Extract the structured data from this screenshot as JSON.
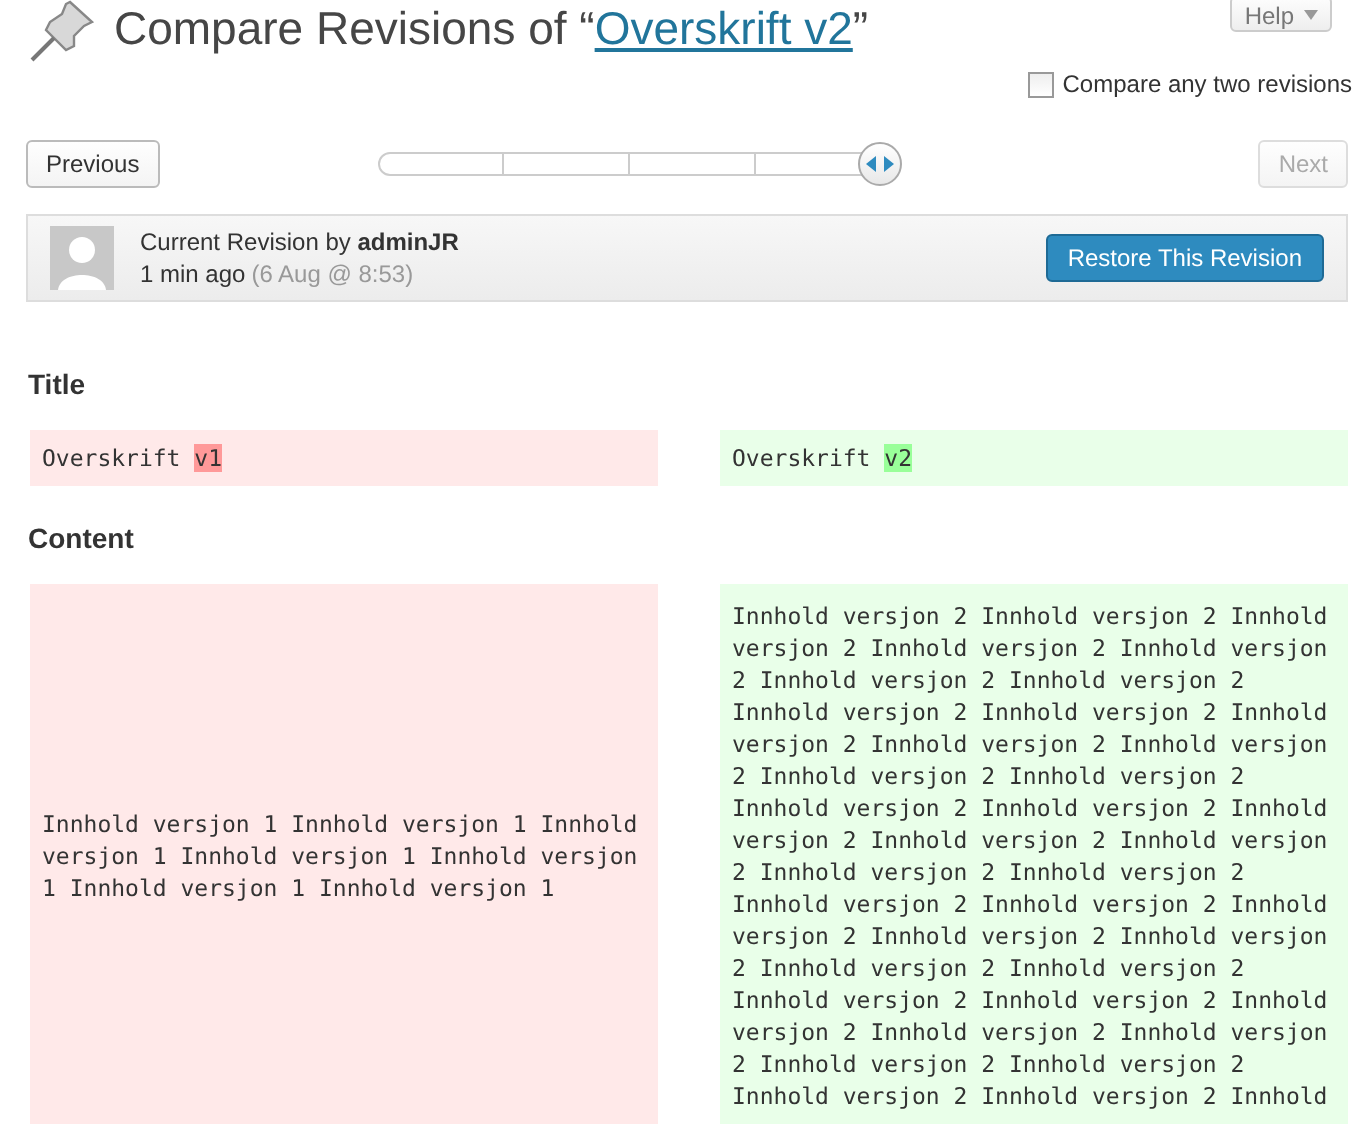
{
  "header": {
    "title_prefix": "Compare Revisions of “",
    "title_link": "Overskrift v2",
    "title_suffix": "”",
    "help_button": "Help"
  },
  "compare_any": {
    "label": "Compare any two revisions",
    "checked": false
  },
  "navigation": {
    "previous": {
      "label": "Previous",
      "disabled": false
    },
    "next": {
      "label": "Next",
      "disabled": true
    },
    "slider": {
      "level": 1
    }
  },
  "revision": {
    "label": "Current Revision by",
    "author": "adminJR",
    "time_ago": "1 min ago",
    "date": "(6 Aug @ 8:53)",
    "restore_button": "Restore This Revision"
  },
  "fields": [
    {
      "heading": "Title",
      "old": [
        [
          {
            "text": "Overskrift ",
            "changed": false
          },
          {
            "text": "v1",
            "changed": true
          }
        ]
      ],
      "new": [
        [
          {
            "text": "Overskrift ",
            "changed": false
          },
          {
            "text": "v2",
            "changed": true
          }
        ]
      ]
    },
    {
      "heading": "Content",
      "old": [
        [
          {
            "text": "Innhold versjon 1 Innhold versjon 1 Innhold versjon 1 Innhold versjon 1 Innhold versjon 1 Innhold versjon 1 Innhold versjon 1",
            "changed": false
          }
        ]
      ],
      "new": [
        [
          {
            "text": "Innhold versjon 2 Innhold versjon 2 Innhold versjon 2 Innhold versjon 2 Innhold versjon 2 Innhold versjon 2 Innhold versjon 2",
            "changed": false
          }
        ],
        [
          {
            "text": "Innhold versjon 2 Innhold versjon 2 Innhold versjon 2 Innhold versjon 2 Innhold versjon 2 Innhold versjon 2 Innhold versjon 2",
            "changed": false
          }
        ],
        [
          {
            "text": "Innhold versjon 2 Innhold versjon 2 Innhold versjon 2 Innhold versjon 2 Innhold versjon 2 Innhold versjon 2 Innhold versjon 2",
            "changed": false
          }
        ],
        [
          {
            "text": "Innhold versjon 2 Innhold versjon 2 Innhold versjon 2 Innhold versjon 2 Innhold versjon 2 Innhold versjon 2 Innhold versjon 2",
            "changed": false
          }
        ],
        [
          {
            "text": "Innhold versjon 2 Innhold versjon 2 Innhold versjon 2 Innhold versjon 2 Innhold versjon 2 Innhold versjon 2 Innhold versjon 2",
            "changed": false
          }
        ],
        [
          {
            "text": "Innhold versjon 2 Innhold versjon 2 Innhold",
            "changed": false
          }
        ]
      ]
    }
  ]
}
